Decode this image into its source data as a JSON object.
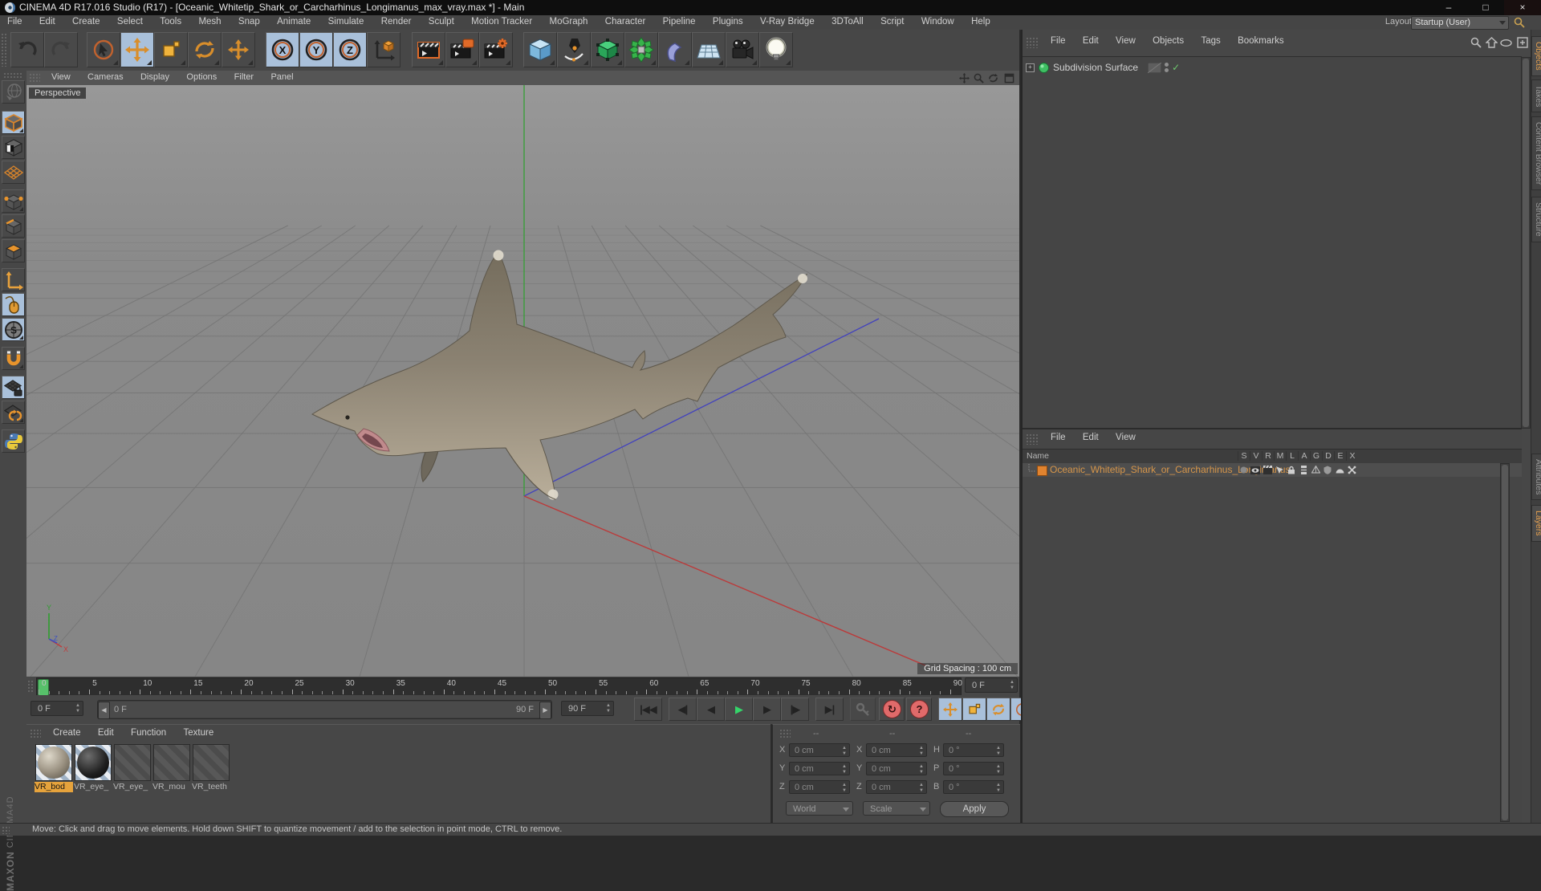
{
  "titlebar": {
    "title": "CINEMA 4D R17.016 Studio (R17) - [Oceanic_Whitetip_Shark_or_Carcharhinus_Longimanus_max_vray.max *] - Main",
    "minimize": "–",
    "maximize": "□",
    "close": "×"
  },
  "menubar": {
    "items": [
      "File",
      "Edit",
      "Create",
      "Select",
      "Tools",
      "Mesh",
      "Snap",
      "Animate",
      "Simulate",
      "Render",
      "Sculpt",
      "Motion Tracker",
      "MoGraph",
      "Character",
      "Pipeline",
      "Plugins",
      "V-Ray Bridge",
      "3DToAll",
      "Script",
      "Window",
      "Help"
    ],
    "layout_label": "Layout:",
    "layout_value": "Startup (User)"
  },
  "viewport": {
    "menu": [
      "View",
      "Cameras",
      "Display",
      "Options",
      "Filter",
      "Panel"
    ],
    "camera_label": "Perspective",
    "grid_spacing_label": "Grid Spacing : 100 cm",
    "axis_labels": {
      "x": "X",
      "y": "Y",
      "z": "Z"
    }
  },
  "timeline": {
    "tick_labels": [
      "0",
      "5",
      "10",
      "15",
      "20",
      "25",
      "30",
      "35",
      "40",
      "45",
      "50",
      "55",
      "60",
      "65",
      "70",
      "75",
      "80",
      "85",
      "90"
    ],
    "current_frame": "0 F",
    "range_start": "0 F",
    "range_end": "90 F",
    "end_frame": "90 F",
    "glyphs": {
      "goto_start": "|◀◀",
      "prev_key": "◀|",
      "prev_frame": "◀",
      "play": "▶",
      "next_frame": "▶",
      "next_key": "|▶",
      "goto_end": "▶|",
      "autokey": "↻",
      "help": "?",
      "param": "P"
    }
  },
  "materials": {
    "menu": [
      "Create",
      "Edit",
      "Function",
      "Texture"
    ],
    "items": [
      {
        "label": "VR_bod",
        "selected": true
      },
      {
        "label": "VR_eye_",
        "selected": false
      },
      {
        "label": "VR_eye_",
        "selected": false
      },
      {
        "label": "VR_mou",
        "selected": false
      },
      {
        "label": "VR_teeth",
        "selected": false
      }
    ]
  },
  "coordinates": {
    "headers": [
      "--",
      "--",
      "--"
    ],
    "rows": [
      {
        "l1": "X",
        "v1": "0 cm",
        "l2": "X",
        "v2": "0 cm",
        "l3": "H",
        "v3": "0 °"
      },
      {
        "l1": "Y",
        "v1": "0 cm",
        "l2": "Y",
        "v2": "0 cm",
        "l3": "P",
        "v3": "0 °"
      },
      {
        "l1": "Z",
        "v1": "0 cm",
        "l2": "Z",
        "v2": "0 cm",
        "l3": "B",
        "v3": "0 °"
      }
    ],
    "mode_position": "World",
    "mode_size": "Scale",
    "apply_label": "Apply"
  },
  "object_manager": {
    "menu": [
      "File",
      "Edit",
      "View",
      "Objects",
      "Tags",
      "Bookmarks"
    ],
    "objects": [
      {
        "name": "Subdivision Surface",
        "enabled_check": "✓"
      }
    ]
  },
  "layer_manager": {
    "menu": [
      "File",
      "Edit",
      "View"
    ],
    "name_header": "Name",
    "columns": [
      "S",
      "V",
      "R",
      "M",
      "L",
      "A",
      "G",
      "D",
      "E",
      "X"
    ],
    "rows": [
      {
        "name": "Oceanic_Whitetip_Shark_or_Carcharhinus_Longimanus"
      }
    ]
  },
  "side_tabs": {
    "top": [
      "Objects",
      "Takes",
      "Content Browser",
      "Structure"
    ],
    "bottom": [
      "Attributes",
      "Layers"
    ]
  },
  "statusbar": {
    "text": "Move: Click and drag to move elements. Hold down SHIFT to quantize movement / add to the selection in point mode, CTRL to remove."
  },
  "branding": {
    "line1": "MAXON",
    "line2": "CINEMA4D"
  },
  "colors": {
    "accent_orange": "#e8a13c",
    "selected_blue": "#a9c0da",
    "axis_green": "#2f9e2f",
    "axis_red": "#c03c3c",
    "axis_blue": "#3c3cc0",
    "playhead_green": "#57c06a",
    "panel_bg": "#474747",
    "viewport_gray": "#8a8a8a"
  }
}
